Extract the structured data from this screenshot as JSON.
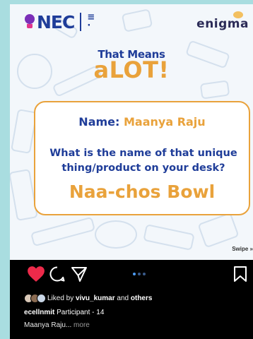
{
  "post": {
    "logos": {
      "left_brand": "NEC",
      "right_brand": "enigma"
    },
    "headline": {
      "top": "That Means",
      "prefix": "a",
      "main": "LOT!"
    },
    "card": {
      "name_label": "Name:",
      "name_value": "Maanya Raju",
      "question": "What is the name of that unique thing/product on your desk?",
      "answer": "Naa-chos Bowl"
    },
    "swipe_hint": "Swipe »"
  },
  "actions": {
    "like_icon": "heart-filled-icon",
    "comment_icon": "comment-icon",
    "share_icon": "send-icon",
    "save_icon": "bookmark-icon",
    "heart_color": "#ed2a4a",
    "carousel_dots": 3,
    "carousel_active": 0
  },
  "likes": {
    "prefix": "Liked by",
    "user": "vivu_kumar",
    "joiner": "and",
    "others": "others"
  },
  "caption": {
    "user": "ecellnmit",
    "text": "Participant - 14",
    "line2": "Maanya Raju...",
    "more": "more"
  },
  "colors": {
    "navy": "#1f3d99",
    "orange": "#e9a23b",
    "background": "#a9dde0"
  }
}
